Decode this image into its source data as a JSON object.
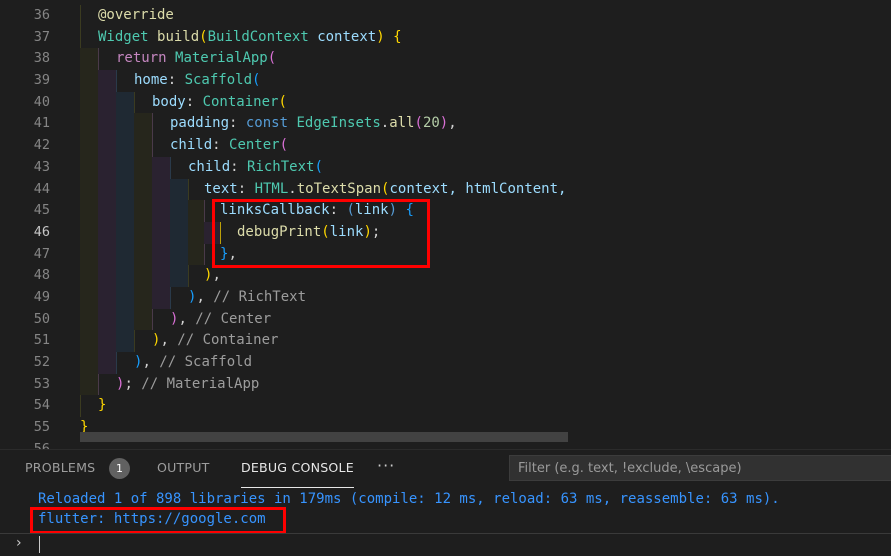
{
  "editor": {
    "line_numbers": [
      "36",
      "37",
      "38",
      "39",
      "40",
      "41",
      "42",
      "43",
      "44",
      "45",
      "46",
      "47",
      "48",
      "49",
      "50",
      "51",
      "52",
      "53",
      "54",
      "55",
      "56"
    ],
    "active_line": "46",
    "lines": {
      "l36": {
        "t1": "@override"
      },
      "l37": {
        "t1": "Widget",
        "t2": " ",
        "t3": "build",
        "t4": "(",
        "t5": "BuildContext",
        "t6": " context",
        "t7": ")",
        "t8": " ",
        "t9": "{"
      },
      "l38": {
        "t1": "return",
        "t2": " ",
        "t3": "MaterialApp",
        "t4": "("
      },
      "l39": {
        "t1": "home",
        "t2": ": ",
        "t3": "Scaffold",
        "t4": "("
      },
      "l40": {
        "t1": "body",
        "t2": ": ",
        "t3": "Container",
        "t4": "("
      },
      "l41": {
        "t1": "padding",
        "t2": ": ",
        "t3": "const",
        "t4": " ",
        "t5": "EdgeInsets",
        "t6": ".",
        "t7": "all",
        "t8": "(",
        "t9": "20",
        "t10": ")",
        "t11": ","
      },
      "l42": {
        "t1": "child",
        "t2": ": ",
        "t3": "Center",
        "t4": "("
      },
      "l43": {
        "t1": "child",
        "t2": ": ",
        "t3": "RichText",
        "t4": "("
      },
      "l44": {
        "t1": "text",
        "t2": ": ",
        "t3": "HTML",
        "t4": ".",
        "t5": "toTextSpan",
        "t6": "(",
        "t7": "context, htmlContent,"
      },
      "l45": {
        "t1": "linksCallback",
        "t2": ": ",
        "t3": "(",
        "t4": "link",
        "t5": ")",
        "t6": " ",
        "t7": "{"
      },
      "l46": {
        "t1": "debugPrint",
        "t2": "(",
        "t3": "link",
        "t4": ")",
        "t5": ";"
      },
      "l47": {
        "t1": "}",
        "t2": ","
      },
      "l48": {
        "t1": ")",
        "t2": ","
      },
      "l49": {
        "t1": ")",
        "t2": ", ",
        "t3": "// RichText"
      },
      "l50": {
        "t1": ")",
        "t2": ", ",
        "t3": "// Center"
      },
      "l51": {
        "t1": ")",
        "t2": ", ",
        "t3": "// Container"
      },
      "l52": {
        "t1": ")",
        "t2": ", ",
        "t3": "// Scaffold"
      },
      "l53": {
        "t1": ")",
        "t2": "; ",
        "t3": "// MaterialApp"
      },
      "l54": {
        "t1": "}"
      },
      "l55": {
        "t1": "}"
      }
    }
  },
  "panel": {
    "tabs": {
      "problems": "PROBLEMS",
      "problems_count": "1",
      "output": "OUTPUT",
      "debug_console": "DEBUG CONSOLE",
      "more": "···"
    },
    "filter_placeholder": "Filter (e.g. text, !exclude, \\escape)",
    "console_lines": {
      "reload": "Reloaded 1 of 898 libraries in 179ms (compile: 12 ms, reload: 63 ms, reassemble: 63 ms).",
      "flutter": "flutter: https://google.com"
    },
    "prompt": "›"
  },
  "colors": {
    "highlight_box": "#ff0000",
    "console_text": "#3794ff",
    "editor_bg": "#1e1e1e"
  }
}
